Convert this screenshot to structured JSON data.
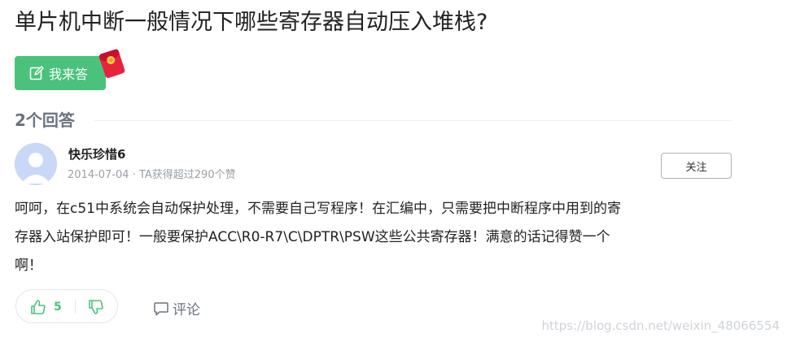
{
  "question": {
    "title": "单片机中断一般情况下哪些寄存器自动压入堆栈?"
  },
  "actions": {
    "answer_label": "我来答"
  },
  "answers": {
    "count_label": "2个回答"
  },
  "answer": {
    "author_name": "快乐珍惜6",
    "meta": "2014-07-04 · TA获得超过290个赞",
    "follow_label": "关注",
    "body_lines": [
      "呵呵，在c51中系统会自动保护处理，不需要自己写程序！在汇编中，只需要把中断程序中用到的寄",
      "存器入站保护即可！一般要保护ACC\\R0-R7\\C\\DPTR\\PSW这些公共寄存器！满意的话记得赞一个",
      "啊！"
    ],
    "upvote_count": "5",
    "comment_label": "评论"
  },
  "watermark": "https://blog.csdn.net/weixin_48066554",
  "colors": {
    "accent_green": "#4bc27c",
    "muted_gray": "#6b7280",
    "red_packet": "#e8233d"
  },
  "icons": {
    "answer_button_icon": "edit-icon",
    "promo_icon": "red-packet-icon",
    "upvote_icon": "thumbs-up-icon",
    "downvote_icon": "thumbs-down-icon",
    "comment_icon": "comment-icon"
  }
}
